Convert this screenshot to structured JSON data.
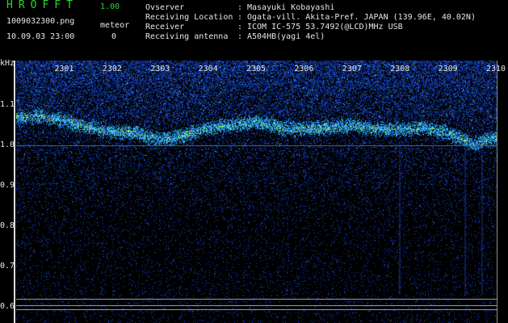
{
  "header": {
    "app_title": "HROFFT",
    "app_version": "1.00",
    "file_name": "1009032300.png",
    "meteor_label": "meteor",
    "datetime": "10.09.03 23:00",
    "meteor_count": "0",
    "fields": [
      {
        "label": "Ovserver",
        "value": "Masayuki Kobayashi"
      },
      {
        "label": "Receiving Location",
        "value": "Ogata-vill. Akita-Pref. JAPAN (139.96E, 40.02N)"
      },
      {
        "label": "Receiver",
        "value": "ICOM IC-575 53.7492(@LCD)MHz USB"
      },
      {
        "label": "Receiving antenna",
        "value": "A504HB(yagi 4el)"
      }
    ]
  },
  "chart_data": {
    "type": "heatmap",
    "ylabel": "kHz",
    "x_ticks": [
      "2301",
      "2302",
      "2303",
      "2304",
      "2305",
      "2306",
      "2307",
      "2308",
      "2309",
      "2310"
    ],
    "y_ticks": [
      "1.1",
      "1.0",
      "0.9",
      "0.8",
      "0.7",
      "0.6"
    ],
    "xlim": [
      2300,
      2310
    ],
    "ylim": [
      0.58,
      1.15
    ],
    "signal_trace": [
      {
        "x": 2300.0,
        "y": 1.07
      },
      {
        "x": 2300.5,
        "y": 1.075
      },
      {
        "x": 2301.0,
        "y": 1.06
      },
      {
        "x": 2301.5,
        "y": 1.045
      },
      {
        "x": 2302.0,
        "y": 1.035
      },
      {
        "x": 2302.5,
        "y": 1.03
      },
      {
        "x": 2303.0,
        "y": 1.015
      },
      {
        "x": 2303.5,
        "y": 1.025
      },
      {
        "x": 2304.0,
        "y": 1.045
      },
      {
        "x": 2304.5,
        "y": 1.05
      },
      {
        "x": 2305.0,
        "y": 1.06
      },
      {
        "x": 2305.5,
        "y": 1.045
      },
      {
        "x": 2306.0,
        "y": 1.04
      },
      {
        "x": 2306.5,
        "y": 1.045
      },
      {
        "x": 2307.0,
        "y": 1.05
      },
      {
        "x": 2307.5,
        "y": 1.04
      },
      {
        "x": 2308.0,
        "y": 1.04
      },
      {
        "x": 2308.5,
        "y": 1.045
      },
      {
        "x": 2309.0,
        "y": 1.03
      },
      {
        "x": 2309.5,
        "y": 1.005
      },
      {
        "x": 2310.0,
        "y": 1.02
      }
    ],
    "reference_lines_khz": [
      1.0,
      0.62,
      0.605,
      0.595
    ],
    "colors": {
      "background": "#000000",
      "noise": "#1a2a9a",
      "signal": "#30c8ff",
      "peak": "#b8ff60",
      "ref_line": "#9a9a9a"
    }
  }
}
